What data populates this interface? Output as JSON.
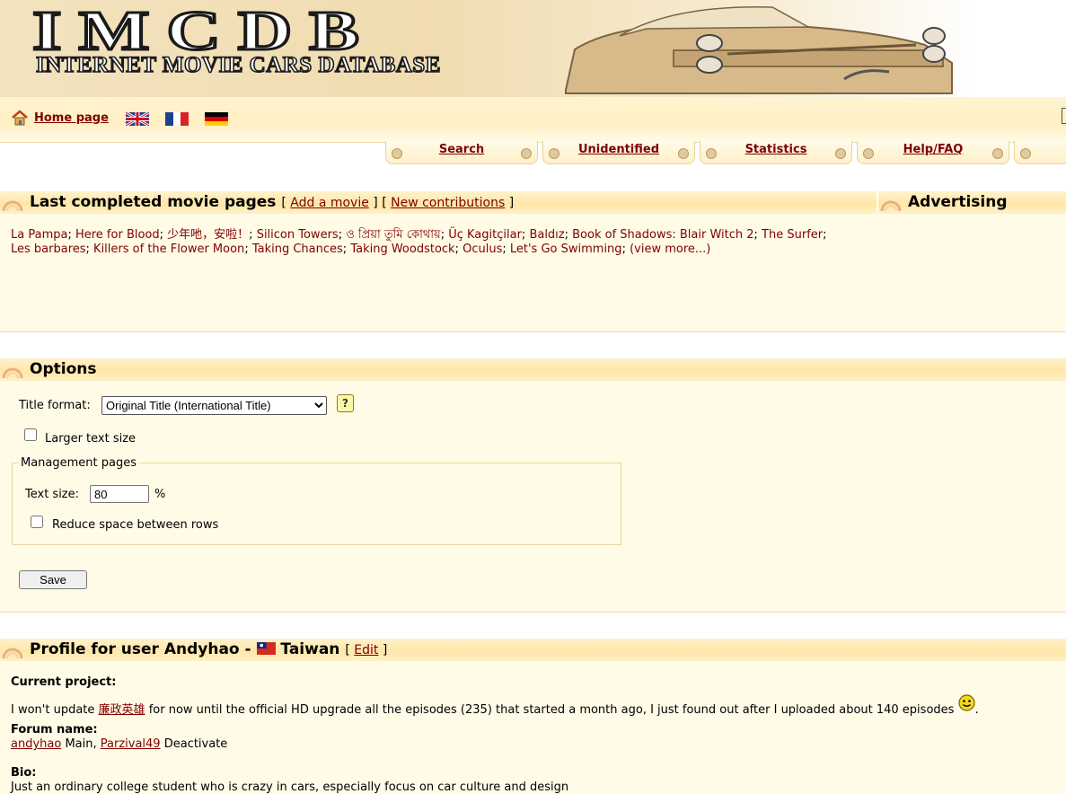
{
  "banner": {
    "logo": "IMCDB",
    "subtitle": "INTERNET MOVIE CARS DATABASE"
  },
  "nav": {
    "home_label": "Home page",
    "flags": [
      "english-flag",
      "french-flag",
      "german-flag"
    ],
    "tabs": [
      "Search",
      "Unidentified",
      "Statistics",
      "Help/FAQ"
    ]
  },
  "last_completed": {
    "title": "Last completed movie pages",
    "add_movie": "Add a movie",
    "new_contributions": "New contributions",
    "movies": [
      "La Pampa",
      "Here for Blood",
      "少年吔，安啦！",
      "Silicon Towers",
      "ও প্রিয়া তুমি কোথায়",
      "Üç Kagitçilar",
      "Baldız",
      "Book of Shadows: Blair Witch 2",
      "The Surfer",
      "Les barbares",
      "Killers of the Flower Moon",
      "Taking Chances",
      "Taking Woodstock",
      "Oculus",
      "Let's Go Swimming"
    ],
    "view_more": "(view more...)"
  },
  "advertising": {
    "title": "Advertising"
  },
  "options": {
    "title": "Options",
    "title_format_label": "Title format:",
    "title_format_value": "Original Title (International Title)",
    "larger_text_label": "Larger text size",
    "management_legend": "Management pages",
    "text_size_label": "Text size:",
    "text_size_value": "80",
    "text_size_unit": "%",
    "reduce_space_label": "Reduce space between rows",
    "save_label": "Save"
  },
  "profile": {
    "title_prefix": "Profile for user Andyhao - ",
    "country": "Taiwan",
    "edit_label": "Edit",
    "current_project_label": "Current project:",
    "current_project_pre": "I won't update ",
    "current_project_link": "廉政英雄",
    "current_project_post": " for now until the official HD upgrade all the episodes (235) that started a month ago, I just found out after I uploaded about 140 episodes ",
    "forum_name_label": "Forum name:",
    "forum_user1": "andyhao",
    "forum_user1_note": " Main, ",
    "forum_user2": "Parzival49",
    "forum_user2_note": " Deactivate",
    "bio_label": "Bio:",
    "bio_text": "Just an ordinary college student who is crazy in cars, especially focus on car culture and design"
  },
  "colors": {
    "link": "#800000",
    "section_band": "#ffe6a8",
    "panel_bg": "#fffbe7",
    "border": "#ebd49a"
  }
}
